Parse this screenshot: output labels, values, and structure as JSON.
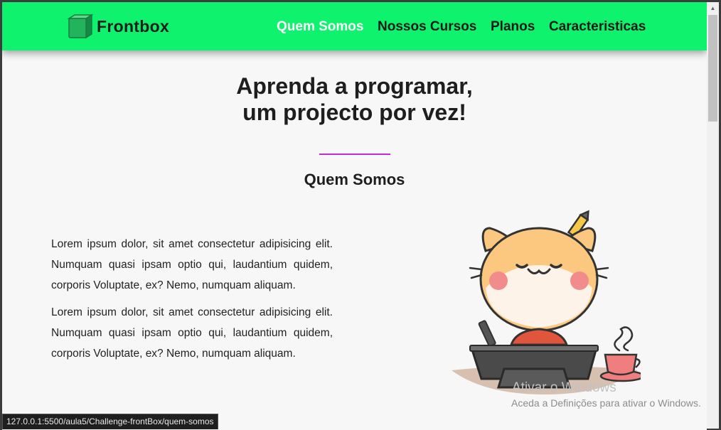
{
  "navbar": {
    "brand": "Frontbox",
    "links": [
      "Quem Somos",
      "Nossos Cursos",
      "Planos",
      "Caracteristicas"
    ],
    "active_index": 0,
    "color": "#0ef26d"
  },
  "hero": {
    "line1": "Aprenda a programar,",
    "line2": "um projecto por vez!"
  },
  "section": {
    "title": "Quem Somos",
    "divider_color": "#c32ad6",
    "paragraphs": [
      "Lorem ipsum dolor, sit amet consectetur adipisicing elit. Numquam quasi ipsam optio qui, laudantium quidem, corporis Voluptate, ex? Nemo, numquam aliquam.",
      "Lorem ipsum dolor, sit amet consectetur adipisicing elit. Numquam quasi ipsam optio qui, laudantium quidem, corporis Voluptate, ex? Nemo, numquam aliquam."
    ],
    "illustration": "cat-at-laptop-illustration"
  },
  "watermark": {
    "line1": "Ativar o Windows",
    "line2": "Aceda a Definições para ativar o Windows."
  },
  "statusbar": {
    "url": "127.0.0.1:5500/aula5/Challenge-frontBox/quem-somos"
  },
  "icons": {
    "logo": "green-cube-logo-icon",
    "scroll_up": "scroll-up-arrow-icon"
  }
}
